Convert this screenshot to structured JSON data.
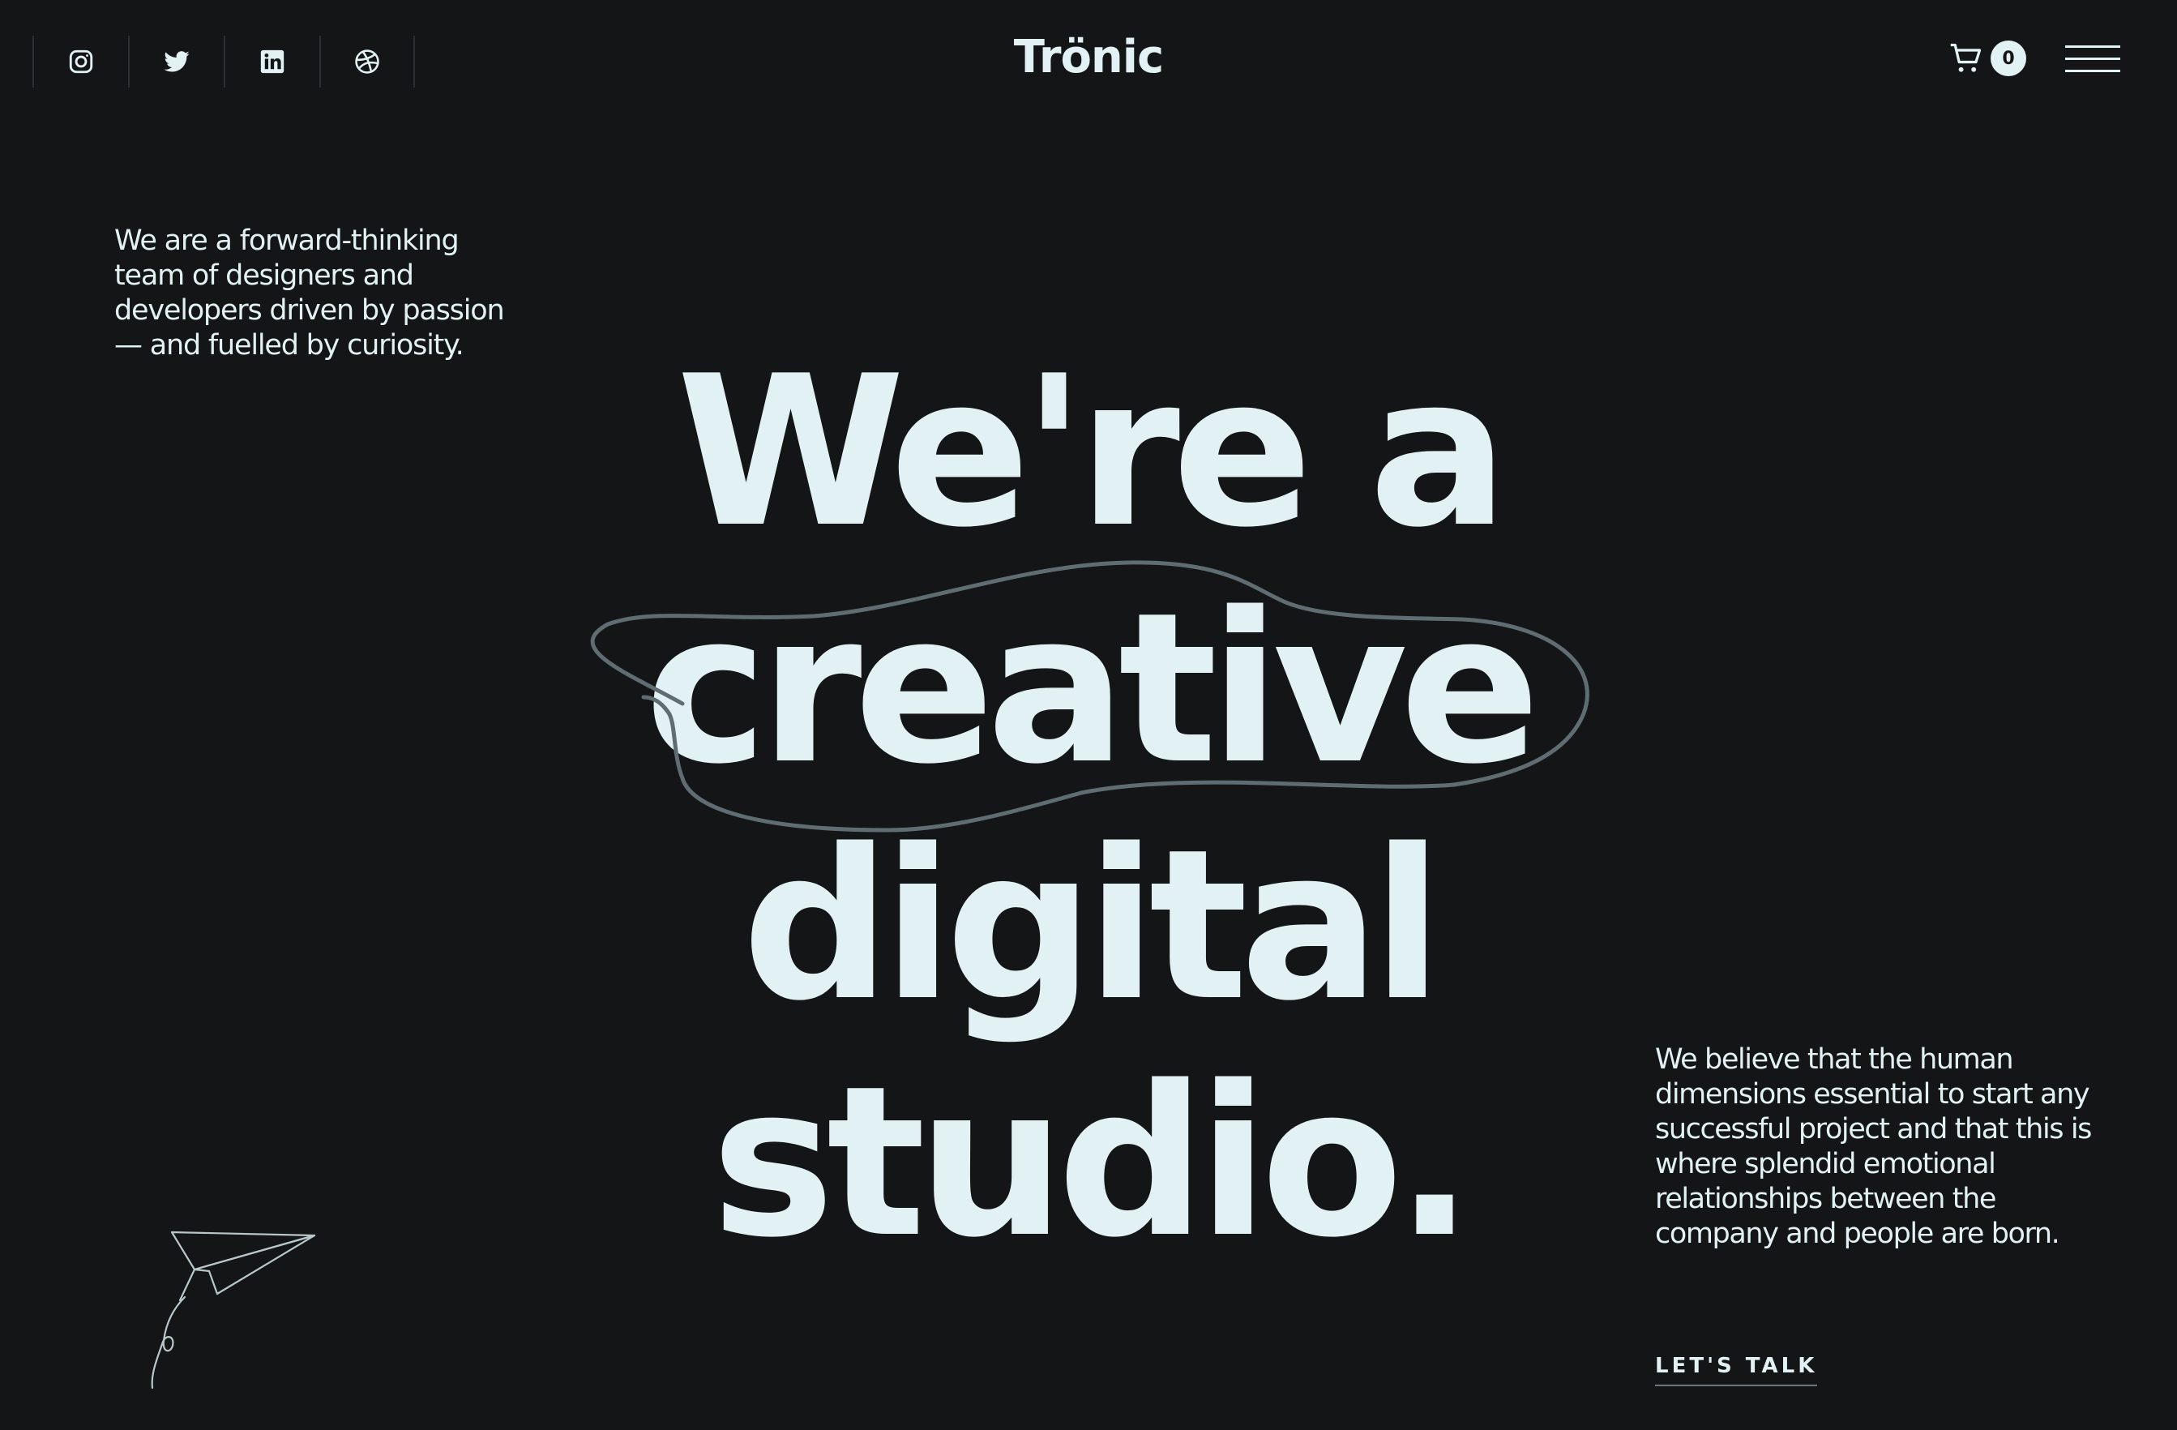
{
  "header": {
    "social_icons": [
      {
        "name": "instagram-icon"
      },
      {
        "name": "twitter-icon"
      },
      {
        "name": "linkedin-icon"
      },
      {
        "name": "dribbble-icon"
      }
    ],
    "logo": "Trönic",
    "cart_count": "0"
  },
  "intro": {
    "text": "We are a forward-thinking team of designers and developers driven by passion — and fuelled by curiosity."
  },
  "hero": {
    "line1": "We're a",
    "line2": "creative",
    "line3": "digital",
    "line4": "studio."
  },
  "belief": {
    "text": "We believe that the human dimensions essential to start any successful project and that this is where splendid emotional relationships between the company and people are born."
  },
  "cta": {
    "label": "LET'S TALK"
  },
  "colors": {
    "background": "#131517",
    "text": "#e2f1f3",
    "scribble": "#5f6d72"
  }
}
